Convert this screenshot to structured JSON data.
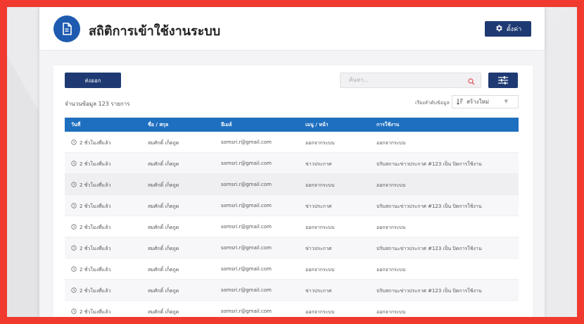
{
  "header": {
    "title": "สถิติการเข้าใช้งานระบบ",
    "settings_label": "ตั้งค่า"
  },
  "toolbar": {
    "export_label": "ส่งออก",
    "search_placeholder": "ค้นหา...",
    "record_count_text": "จำนวนข้อมูล 123 รายการ",
    "sort_label": "เรียงลำดับข้อมูล",
    "sort_value": "สร้างใหม่"
  },
  "table": {
    "columns": [
      "วันที่",
      "ชื่อ / สกุล",
      "อีเมล์",
      "เมนู / หน้า",
      "การใช้งาน"
    ],
    "rows": [
      {
        "date": "2 ชั่วโมงที่แล้ว",
        "name": "สมศักดิ์ เก็ตถูด",
        "email": "somsri.r@gmail.com",
        "menu": "ออกจากระบบ",
        "action": "ออกจากระบบ"
      },
      {
        "date": "2 ชั่วโมงที่แล้ว",
        "name": "สมศักดิ์ เก็ตถูด",
        "email": "somsri.r@gmail.com",
        "menu": "ข่าวประกาศ",
        "action": "ปรับสถานะข่าวประกาศ #123 เป็น ปิดการใช้งาน"
      },
      {
        "date": "2 ชั่วโมงที่แล้ว",
        "name": "สมศักดิ์ เก็ตถูด",
        "email": "somsri.r@gmail.com",
        "menu": "ออกจากระบบ",
        "action": "ออกจากระบบ"
      },
      {
        "date": "2 ชั่วโมงที่แล้ว",
        "name": "สมศักดิ์ เก็ตถูด",
        "email": "somsri.r@gmail.com",
        "menu": "ข่าวประกาศ",
        "action": "ปรับสถานะข่าวประกาศ #123 เป็น ปิดการใช้งาน"
      },
      {
        "date": "2 ชั่วโมงที่แล้ว",
        "name": "สมศักดิ์ เก็ตถูด",
        "email": "somsri.r@gmail.com",
        "menu": "ออกจากระบบ",
        "action": "ออกจากระบบ"
      },
      {
        "date": "2 ชั่วโมงที่แล้ว",
        "name": "สมศักดิ์ เก็ตถูด",
        "email": "somsri.r@gmail.com",
        "menu": "ข่าวประกาศ",
        "action": "ปรับสถานะข่าวประกาศ #123 เป็น ปิดการใช้งาน"
      },
      {
        "date": "2 ชั่วโมงที่แล้ว",
        "name": "สมศักดิ์ เก็ตถูด",
        "email": "somsri.r@gmail.com",
        "menu": "ออกจากระบบ",
        "action": "ออกจากระบบ"
      },
      {
        "date": "2 ชั่วโมงที่แล้ว",
        "name": "สมศักดิ์ เก็ตถูด",
        "email": "somsri.r@gmail.com",
        "menu": "ข่าวประกาศ",
        "action": "ปรับสถานะข่าวประกาศ #123 เป็น ปิดการใช้งาน"
      },
      {
        "date": "2 ชั่วโมงที่แล้ว",
        "name": "สมศักดิ์ เก็ตถูด",
        "email": "somsri.r@gmail.com",
        "menu": "ออกจากระบบ",
        "action": "ออกจากระบบ"
      }
    ]
  },
  "icons": {
    "header": "document-icon",
    "settings": "gear-icon",
    "search": "search-icon",
    "filter": "sliders-icon",
    "sort": "sort-icon",
    "row": "clock-icon"
  },
  "colors": {
    "frame": "#f03a30",
    "primary": "#1f3a73",
    "accent": "#1e6fbf",
    "header_icon": "#1e5bb0",
    "search_icon": "#e05050"
  }
}
